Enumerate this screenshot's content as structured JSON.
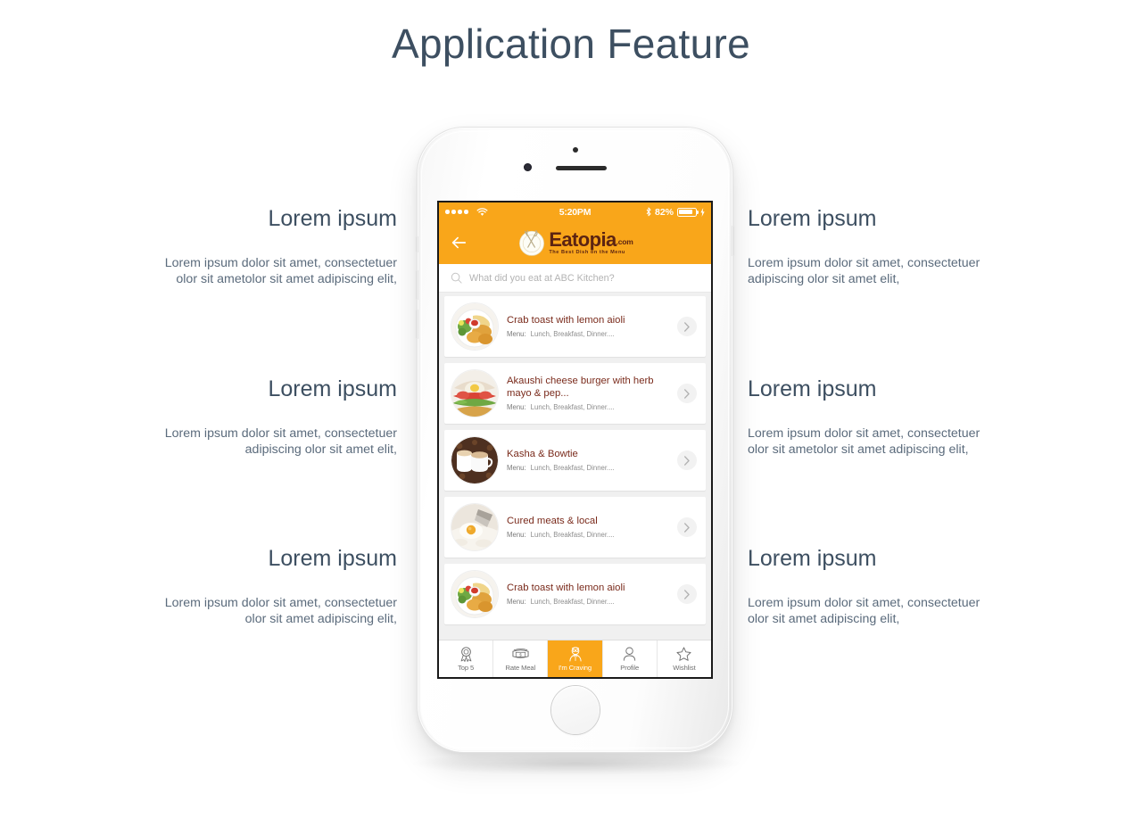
{
  "page": {
    "title": "Application Feature",
    "title_color": "#3d4f61",
    "background": "#ffffff"
  },
  "features": {
    "left": [
      {
        "title": "Lorem ipsum",
        "body": "Lorem ipsum dolor sit amet, consectetuer olor sit ametolor sit amet adipiscing elit,"
      },
      {
        "title": "Lorem ipsum",
        "body": "Lorem ipsum dolor sit amet, consectetuer adipiscing  olor sit amet elit,"
      },
      {
        "title": "Lorem ipsum",
        "body": "Lorem ipsum dolor sit amet, consectetuer olor sit amet adipiscing elit,"
      }
    ],
    "right": [
      {
        "title": "Lorem ipsum",
        "body": "Lorem ipsum dolor sit amet, consectetuer adipiscing  olor sit amet elit,"
      },
      {
        "title": "Lorem ipsum",
        "body": "Lorem ipsum dolor sit amet, consectetuer olor sit ametolor sit amet adipiscing elit,"
      },
      {
        "title": "Lorem ipsum",
        "body": "Lorem ipsum dolor sit amet, consectetuer olor sit amet adipiscing elit,"
      }
    ]
  },
  "phone": {
    "device_color": "#f7f7f7",
    "accent_color": "#f9a61a",
    "status_bar": {
      "signal_dots": 4,
      "wifi_icon": "wifi-icon",
      "time": "5:20PM",
      "bluetooth_icon": "bluetooth-icon",
      "battery_percent": "82%",
      "battery_level": 82,
      "charging_icon": "lightning-bolt-icon"
    },
    "app_header": {
      "back_icon": "back-arrow-icon",
      "logo_icon": "plate-with-cutlery-icon",
      "logo_name": "Eatopia",
      "logo_suffix": ".com",
      "logo_tagline": "The Best Dish on the Menu",
      "logo_text_color": "#5c2412"
    },
    "search": {
      "icon": "search-icon",
      "placeholder": "What did you eat at ABC Kitchen?",
      "value": ""
    },
    "list": [
      {
        "title": "Crab toast with lemon aioli",
        "menu_label": "Menu:",
        "menu_value": "Lunch, Breakfast, Dinner....",
        "thumb": "fried-chicken-plate-image",
        "chevron": "chevron-right-icon"
      },
      {
        "title": "Akaushi cheese burger with herb mayo & pep...",
        "menu_label": "Menu:",
        "menu_value": "Lunch, Breakfast, Dinner....",
        "thumb": "cheese-burger-image",
        "chevron": "chevron-right-icon"
      },
      {
        "title": "Kasha & Bowtie",
        "menu_label": "Menu:",
        "menu_value": "Lunch, Breakfast, Dinner....",
        "thumb": "coffee-cups-image",
        "chevron": "chevron-right-icon"
      },
      {
        "title": "Cured meats & local",
        "menu_label": "Menu:",
        "menu_value": "Lunch, Breakfast, Dinner....",
        "thumb": "egg-on-rice-image",
        "chevron": "chevron-right-icon"
      },
      {
        "title": "Crab toast with lemon aioli",
        "menu_label": "Menu:",
        "menu_value": "Lunch, Breakfast, Dinner....",
        "thumb": "fried-chicken-plate-image",
        "chevron": "chevron-right-icon"
      }
    ],
    "tabs": [
      {
        "label": "Top 5",
        "icon": "award-ribbon-icon",
        "active": false
      },
      {
        "label": "Rate Meal",
        "icon": "money-bill-icon",
        "active": false
      },
      {
        "label": "I'm Craving",
        "icon": "hungry-person-icon",
        "active": true
      },
      {
        "label": "Profile",
        "icon": "user-icon",
        "active": false
      },
      {
        "label": "Wishlist",
        "icon": "star-icon",
        "active": false
      }
    ],
    "home_button": "home-button"
  }
}
